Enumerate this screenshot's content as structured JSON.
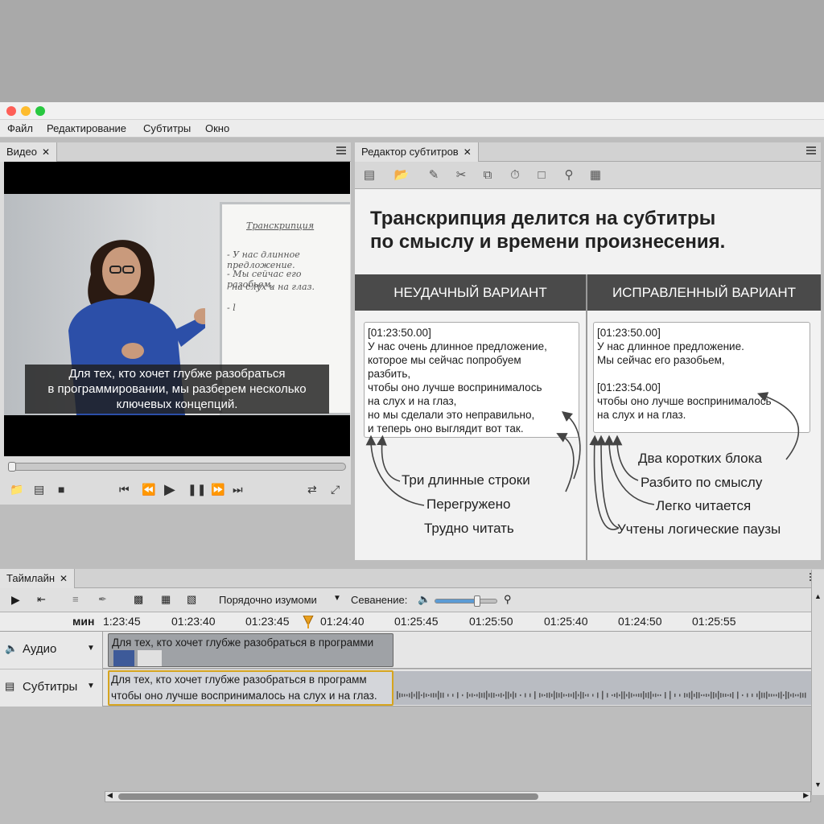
{
  "menu": [
    "Файл",
    "Редактирование",
    "Субтитры",
    "Окно"
  ],
  "video_panel": {
    "tab": "Видео",
    "close": "✕",
    "board": {
      "title": "Транскрипция",
      "lines": [
        "- У нас длинное предложение.",
        "- Мы сейчас его разобьем,",
        "на слух и на глаз.",
        "- l"
      ]
    },
    "subtitle_lines": [
      "Для тех, кто хочет глубже разобраться",
      "в программировании, мы разберем несколько",
      "ключевых концепций."
    ],
    "progress": 0,
    "controls": [
      "folder-icon",
      "import-icon",
      "stop-icon",
      "skip-back-icon",
      "rewind-icon",
      "play-icon",
      "pause-icon",
      "forward-icon",
      "skip-forward-icon",
      "loop-icon",
      "fullscreen-icon"
    ]
  },
  "editor_panel": {
    "tab": "Редактор субтитров",
    "close": "✕",
    "toolbar": [
      "subtitles-icon",
      "folder-icon",
      "brush-icon",
      "scissors-icon",
      "copy-icon",
      "timing-icon",
      "bubble-icon",
      "search-icon",
      "settings-icon"
    ],
    "heading": [
      "Транскрипция делится на субтитры",
      "по смыслу и времени произнесения."
    ],
    "bad": {
      "header": "НЕУДАЧНЫЙ ВАРИАНТ",
      "lines": [
        "[01:23:50.00]",
        "У нас очень длинное предложение,",
        "которое мы сейчас попробуем",
        "разбить,",
        "чтобы оно лучше воспринималось",
        "на слух и на глаз,",
        "но мы сделали это неправильно,",
        "и теперь оно выглядит вот так."
      ],
      "labels": [
        "Три длинные строки",
        "Перегружено",
        "Трудно читать"
      ]
    },
    "good": {
      "header": "ИСПРАВЛЕННЫЙ ВАРИАНТ",
      "lines": [
        "[01:23:50.00]",
        "У нас длинное предложение.",
        "Мы сейчас его разобьем,",
        "",
        "[01:23:54.00]",
        "чтобы оно лучше воспринималось",
        "на слух и на глаз."
      ],
      "labels": [
        "Два коротких блока",
        "Разбито по смыслу",
        "Легко читается",
        "Учтены логические паузы"
      ]
    }
  },
  "timeline": {
    "tab": "Таймлайн",
    "close": "✕",
    "sort_label": "Порядочно изумоми",
    "volume_label": "Севанение:",
    "volume_level": 0.68,
    "unit": "мин",
    "ticks": [
      "1:23:45",
      "01:23:40",
      "01:23:45",
      "01:24:40",
      "01:25:45",
      "01:25:50",
      "01:25:40",
      "01:24:50",
      "01:25:55"
    ],
    "tracks": {
      "audio": {
        "label": "Аудио",
        "clip": "Для тех, кто хочет глубже разобраться в программи"
      },
      "subtitles": {
        "label": "Субтитры",
        "clip_line1": "Для тех, кто хочет глубже разобраться в программ",
        "clip_line2": "чтобы оно лучше воспринималось на слух и на глаз."
      }
    }
  }
}
